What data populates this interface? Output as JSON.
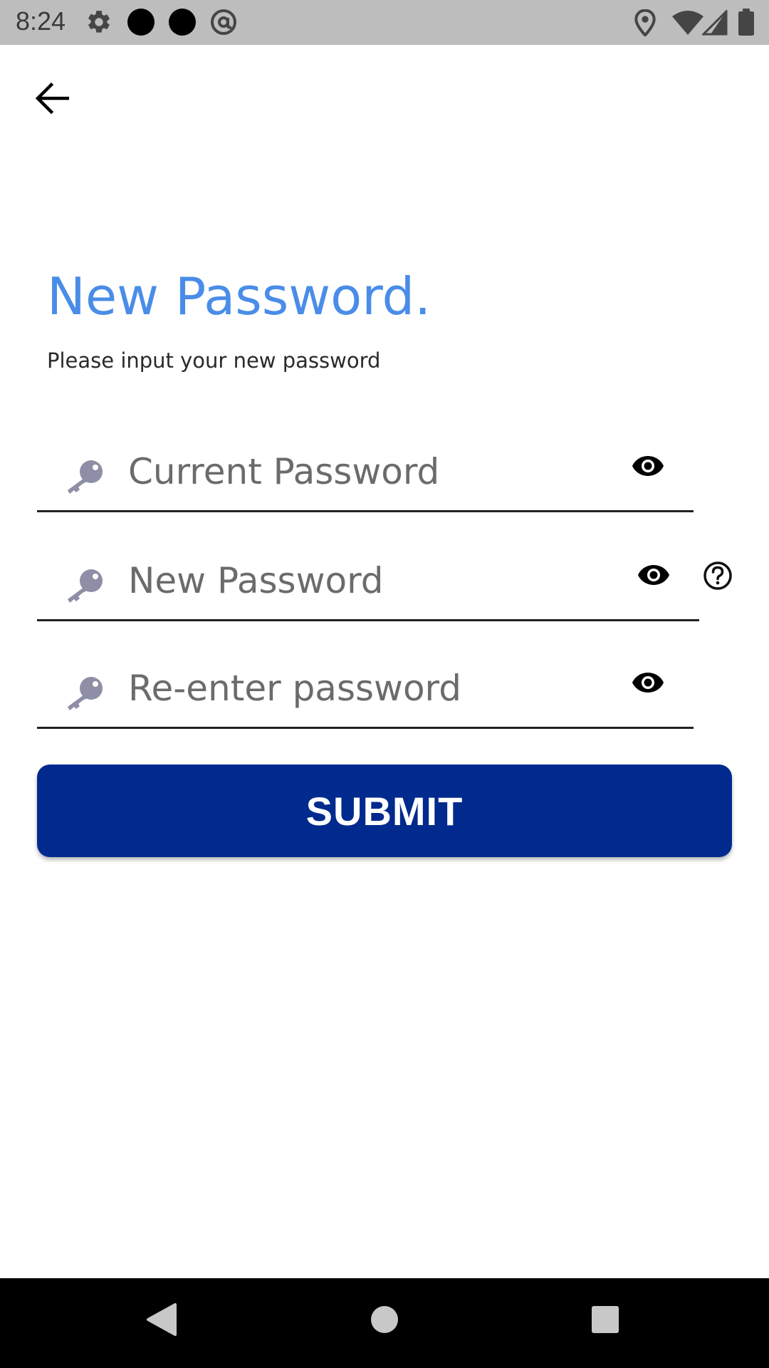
{
  "status_bar": {
    "time": "8:24",
    "left_icons": [
      "gear-icon",
      "notification-dot-icon",
      "notification-dot-icon",
      "at-sign-icon"
    ],
    "right_icons": [
      "location-icon",
      "wifi-icon",
      "signal-icon",
      "battery-icon"
    ]
  },
  "header": {
    "back_icon": "arrow-left-icon"
  },
  "main": {
    "title": "New Password.",
    "subtitle": "Please input your new password",
    "fields": [
      {
        "placeholder": "Current Password",
        "value": "",
        "icon": "key-icon",
        "toggle_icon": "eye-icon"
      },
      {
        "placeholder": "New Password",
        "value": "",
        "icon": "key-icon",
        "toggle_icon": "eye-icon",
        "help_icon": "help-circle-icon"
      },
      {
        "placeholder": "Re-enter password",
        "value": "",
        "icon": "key-icon",
        "toggle_icon": "eye-icon"
      }
    ],
    "submit_label": "SUBMIT"
  },
  "nav_bar": {
    "icons": [
      "back-triangle-icon",
      "home-circle-icon",
      "recents-square-icon"
    ]
  },
  "colors": {
    "accent_title": "#4a8de8",
    "submit_background": "#002a8e",
    "key_icon": "#8e8ea6",
    "status_bar": "#bdbdbd",
    "nav_bar": "#000000"
  }
}
